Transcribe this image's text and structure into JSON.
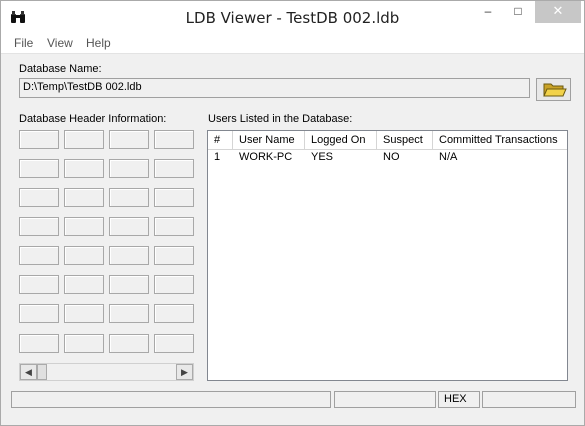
{
  "window": {
    "title": "LDB Viewer - TestDB 002.ldb"
  },
  "titlebar": {
    "minimize": "–",
    "maximize": "□",
    "close": "✕"
  },
  "menu": [
    "File",
    "View",
    "Help"
  ],
  "database": {
    "label": "Database Name:",
    "path": "D:\\Temp\\TestDB 002.ldb"
  },
  "header_info": {
    "label": "Database Header Information:"
  },
  "users": {
    "label": "Users Listed in the Database:",
    "columns": [
      "#",
      "User Name",
      "Logged On",
      "Suspect",
      "Committed Transactions"
    ],
    "rows": [
      [
        "1",
        "WORK-PC",
        "YES",
        "NO",
        "N/A"
      ]
    ]
  },
  "scrollbar": {
    "left": "◀",
    "right": "▶"
  },
  "statusbar": {
    "panel1": "",
    "panel2": "",
    "mode": "HEX",
    "panel4": ""
  },
  "colors": {
    "folder": "#e8c84a",
    "close_button": "#c7c7c7"
  }
}
